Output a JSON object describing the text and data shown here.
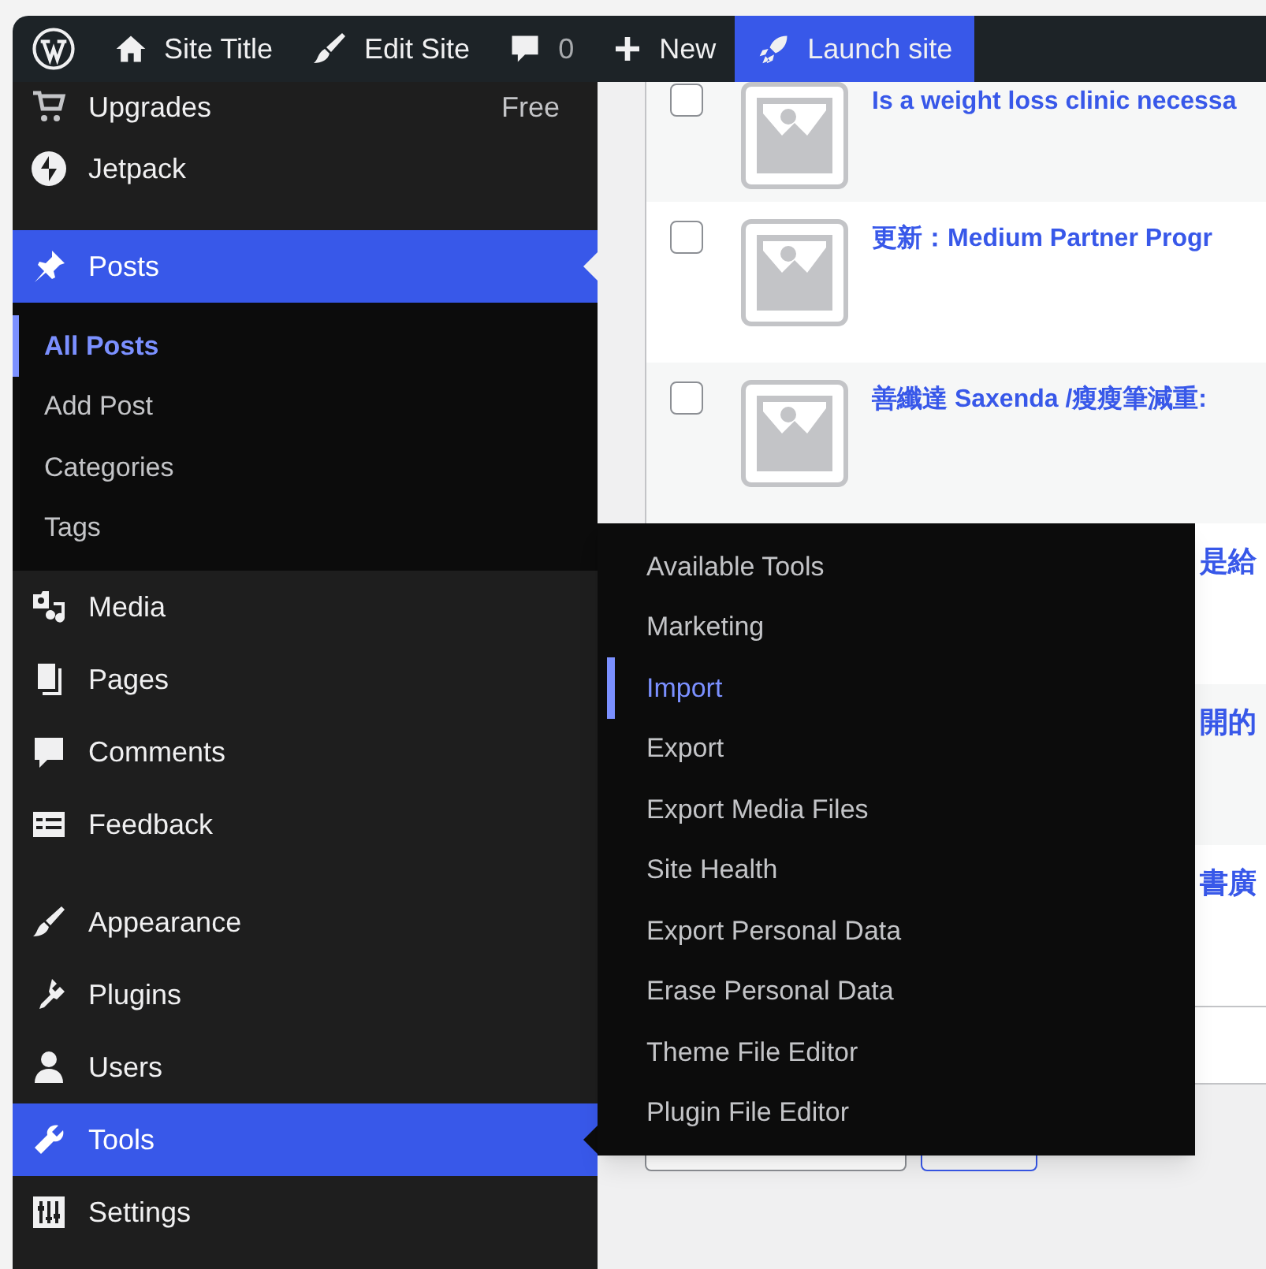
{
  "admin_bar": {
    "items": [
      {
        "kind": "logo"
      },
      {
        "kind": "home",
        "label": "Site Title"
      },
      {
        "kind": "brush",
        "label": "Edit Site"
      },
      {
        "kind": "comments",
        "count": "0"
      },
      {
        "kind": "plus",
        "label": "New"
      },
      {
        "kind": "rocket",
        "label": "Launch site",
        "highlighted": true
      }
    ]
  },
  "sidebar": {
    "items": [
      {
        "label": "Upgrades",
        "badge": "Free",
        "selected": false,
        "flyout_open": false
      },
      {
        "label": "Jetpack",
        "selected": false,
        "flyout_open": false
      },
      {
        "label": "Posts",
        "selected": true,
        "flyout_open": false,
        "submenu": [
          {
            "label": "All Posts",
            "selected": true
          },
          {
            "label": "Add Post",
            "selected": false
          },
          {
            "label": "Categories",
            "selected": false
          },
          {
            "label": "Tags",
            "selected": false
          }
        ]
      },
      {
        "label": "Media",
        "selected": false,
        "flyout_open": false
      },
      {
        "label": "Pages",
        "selected": false,
        "flyout_open": false
      },
      {
        "label": "Comments",
        "selected": false,
        "flyout_open": false
      },
      {
        "label": "Feedback",
        "selected": false,
        "flyout_open": false
      },
      {
        "label": "Appearance",
        "selected": false,
        "flyout_open": false
      },
      {
        "label": "Plugins",
        "selected": false,
        "flyout_open": false
      },
      {
        "label": "Users",
        "selected": false,
        "flyout_open": false
      },
      {
        "label": "Tools",
        "selected": false,
        "flyout_open": true,
        "flyout": [
          {
            "label": "Available Tools",
            "selected": false
          },
          {
            "label": "Marketing",
            "selected": false
          },
          {
            "label": "Import",
            "selected": true
          },
          {
            "label": "Export",
            "selected": false
          },
          {
            "label": "Export Media Files",
            "selected": false
          },
          {
            "label": "Site Health",
            "selected": false
          },
          {
            "label": "Export Personal Data",
            "selected": false
          },
          {
            "label": "Erase Personal Data",
            "selected": false
          },
          {
            "label": "Theme File Editor",
            "selected": false
          },
          {
            "label": "Plugin File Editor",
            "selected": false
          }
        ]
      },
      {
        "label": "Settings",
        "selected": false,
        "flyout_open": false
      }
    ]
  },
  "posts_table": {
    "rows": [
      {
        "kind": "full",
        "checked": false,
        "title": "Is a weight loss clinic necessa"
      },
      {
        "kind": "full",
        "checked": false,
        "title": "更新：Medium Partner Progr"
      },
      {
        "kind": "full",
        "checked": false,
        "title": "善纖達 Saxenda /瘦瘦筆減重:"
      },
      {
        "kind": "partial",
        "title": "是給"
      },
      {
        "kind": "partial",
        "title": "開的"
      },
      {
        "kind": "partial",
        "title": "書廣"
      }
    ]
  }
}
